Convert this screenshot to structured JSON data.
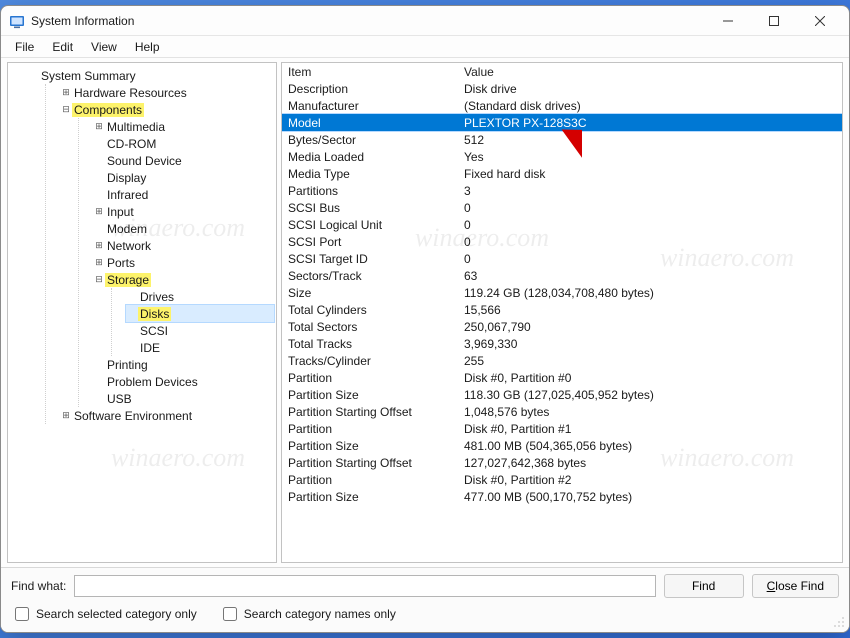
{
  "app_title": "System Information",
  "menu": {
    "file": "File",
    "edit": "Edit",
    "view": "View",
    "help": "Help"
  },
  "tree": {
    "root": "System Summary",
    "hw_res": "Hardware Resources",
    "components": "Components",
    "multimedia": "Multimedia",
    "cdrom": "CD-ROM",
    "sound": "Sound Device",
    "display": "Display",
    "infrared": "Infrared",
    "input": "Input",
    "modem": "Modem",
    "network": "Network",
    "ports": "Ports",
    "storage": "Storage",
    "drives": "Drives",
    "disks": "Disks",
    "scsi": "SCSI",
    "ide": "IDE",
    "printing": "Printing",
    "problem_devices": "Problem Devices",
    "usb": "USB",
    "sw_env": "Software Environment"
  },
  "list_columns": {
    "item": "Item",
    "value": "Value"
  },
  "items": [
    {
      "k": "Description",
      "v": "Disk drive"
    },
    {
      "k": "Manufacturer",
      "v": "(Standard disk drives)"
    },
    {
      "k": "Model",
      "v": "PLEXTOR PX-128S3C",
      "selected": true
    },
    {
      "k": "Bytes/Sector",
      "v": "512"
    },
    {
      "k": "Media Loaded",
      "v": "Yes"
    },
    {
      "k": "Media Type",
      "v": "Fixed hard disk"
    },
    {
      "k": "Partitions",
      "v": "3"
    },
    {
      "k": "SCSI Bus",
      "v": "0"
    },
    {
      "k": "SCSI Logical Unit",
      "v": "0"
    },
    {
      "k": "SCSI Port",
      "v": "0"
    },
    {
      "k": "SCSI Target ID",
      "v": "0"
    },
    {
      "k": "Sectors/Track",
      "v": "63"
    },
    {
      "k": "Size",
      "v": "119.24 GB (128,034,708,480 bytes)"
    },
    {
      "k": "Total Cylinders",
      "v": "15,566"
    },
    {
      "k": "Total Sectors",
      "v": "250,067,790"
    },
    {
      "k": "Total Tracks",
      "v": "3,969,330"
    },
    {
      "k": "Tracks/Cylinder",
      "v": "255"
    },
    {
      "k": "Partition",
      "v": "Disk #0, Partition #0"
    },
    {
      "k": "Partition Size",
      "v": "118.30 GB (127,025,405,952 bytes)"
    },
    {
      "k": "Partition Starting Offset",
      "v": "1,048,576 bytes"
    },
    {
      "k": "Partition",
      "v": "Disk #0, Partition #1"
    },
    {
      "k": "Partition Size",
      "v": "481.00 MB (504,365,056 bytes)"
    },
    {
      "k": "Partition Starting Offset",
      "v": "127,027,642,368 bytes"
    },
    {
      "k": "Partition",
      "v": "Disk #0, Partition #2"
    },
    {
      "k": "Partition Size",
      "v": "477.00 MB (500,170,752 bytes)"
    }
  ],
  "find": {
    "label": "Find what:",
    "value": "",
    "find_btn": "Find",
    "close_btn": "Close Find",
    "opt_selected": "Search selected category only",
    "opt_names": "Search category names only"
  },
  "watermark": "winaero.com"
}
